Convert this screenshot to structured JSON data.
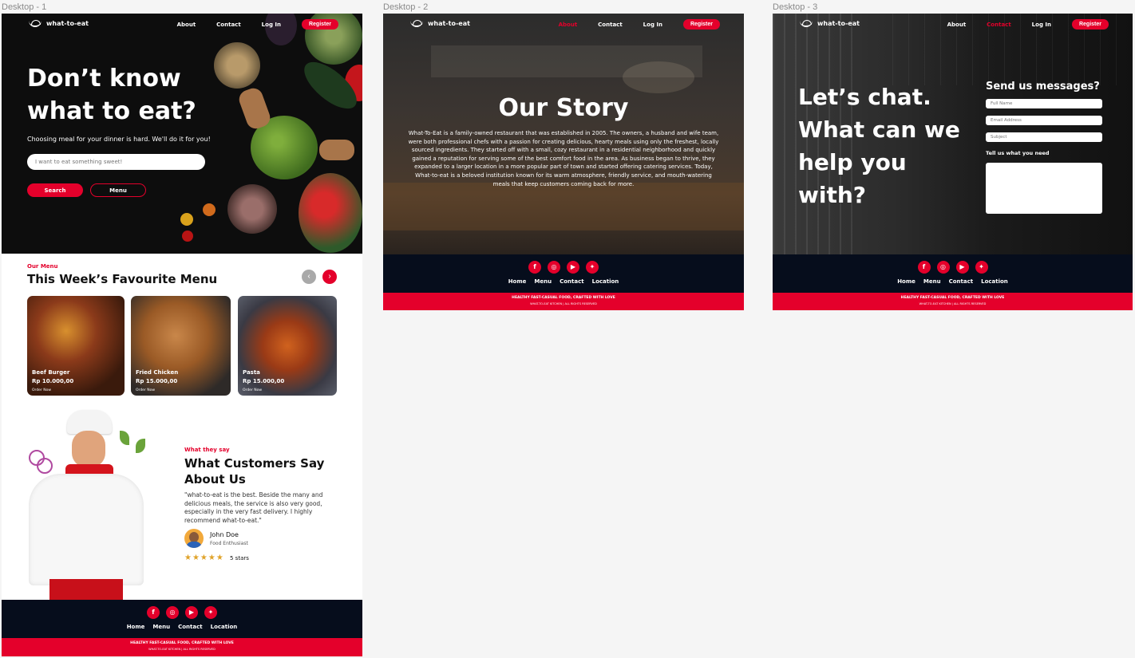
{
  "frames": {
    "d1": "Desktop - 1",
    "d2": "Desktop - 2",
    "d3": "Desktop - 3"
  },
  "nav": {
    "brand": "what-to-eat",
    "about": "About",
    "contact": "Contact",
    "login": "Log In",
    "register": "Register"
  },
  "hero": {
    "title_line1": "Don’t know",
    "title_line2": "what to eat?",
    "subtitle": "Choosing meal for your dinner is hard. We'll do it for you!",
    "search_placeholder": "I want to eat something sweet!",
    "search_button": "Search",
    "menu_button": "Menu"
  },
  "menu_section": {
    "eyebrow": "Our Menu",
    "title": "This Week’s Favourite Menu",
    "prev_icon": "‹",
    "next_icon": "›",
    "items": [
      {
        "name": "Beef Burger",
        "price": "Rp 10.000,00",
        "cta": "Order Now"
      },
      {
        "name": "Fried Chicken",
        "price": "Rp 15.000,00",
        "cta": "Order Now"
      },
      {
        "name": "Pasta",
        "price": "Rp 15.000,00",
        "cta": "Order Now"
      }
    ]
  },
  "testimonial": {
    "eyebrow": "What they say",
    "title_line1": "What Customers Say",
    "title_line2": "About Us",
    "quote": "\"what-to-eat is the best. Beside the many and delicious meals, the service is also very good, especially in the very fast delivery. I highly recommend what-to-eat.\"",
    "author": "John Doe",
    "role": "Food Enthusiast",
    "stars": "★★★★★",
    "rating_text": "5 stars"
  },
  "footer": {
    "social_icons": [
      "f",
      "◎",
      "▶",
      "✦"
    ],
    "links": [
      "Home",
      "Menu",
      "Contact",
      "Location"
    ],
    "tagline": "HEALTHY FAST-CASUAL FOOD, CRAFTED WITH LOVE",
    "rights": "WHAT-TO-EAT KITCHEN | ALL RIGHTS RESERVED"
  },
  "story": {
    "title": "Our Story",
    "body": "What-To-Eat is a family-owned restaurant that was established in 2005. The owners, a husband and wife team, were both professional chefs with a passion for creating delicious, hearty meals using only the freshest, locally sourced ingredients. They started off with a small, cozy restaurant in a residential neighborhood and quickly gained a reputation for serving some of the best comfort food in the area. As business began to thrive, they expanded to a larger location in a more popular part of town and started offering catering services. Today, What-to-eat is a beloved institution known for its warm atmosphere, friendly service, and mouth-watering meals that keep customers coming back for more."
  },
  "contact": {
    "title_line1": "Let’s chat.",
    "title_line2": "What can we",
    "title_line3": "help you",
    "title_line4": "with?",
    "form_title": "Send us messages?",
    "full_name_placeholder": "Full Name",
    "email_placeholder": "Email Address",
    "subject_placeholder": "Subject",
    "message_label": "Tell us what you need"
  },
  "colors": {
    "accent": "#e4002b",
    "footer_dark": "#060d1c"
  }
}
